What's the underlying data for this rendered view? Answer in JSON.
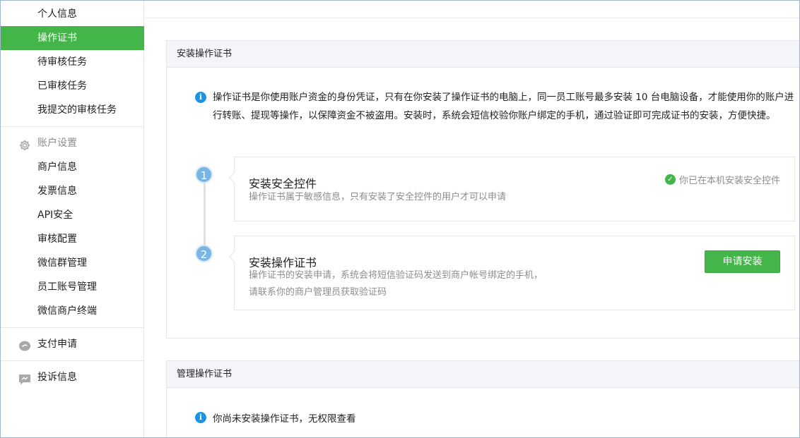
{
  "sidebar": {
    "top_items": [
      {
        "label": "个人信息"
      },
      {
        "label": "操作证书"
      },
      {
        "label": "待审核任务"
      },
      {
        "label": "已审核任务"
      },
      {
        "label": "我提交的审核任务"
      }
    ],
    "account_settings": {
      "title": "账户设置",
      "items": [
        {
          "label": "商户信息"
        },
        {
          "label": "发票信息"
        },
        {
          "label": "API安全"
        },
        {
          "label": "审核配置"
        },
        {
          "label": "微信群管理"
        },
        {
          "label": "员工账号管理"
        },
        {
          "label": "微信商户终端"
        }
      ]
    },
    "payment_apply": {
      "title": "支付申请"
    },
    "complaint_info": {
      "title": "投诉信息"
    }
  },
  "install_panel": {
    "title": "安装操作证书",
    "description": "操作证书是你使用账户资金的身份凭证，只有在你安装了操作证书的电脑上，同一员工账号最多安装 10 台电脑设备，才能使用你的账户进行转账、提现等操作，以保障资金不被盗用。安装时，系统会短信校验你账户绑定的手机，通过验证即可完成证书的安装，方便快捷。",
    "steps": [
      {
        "number": "1",
        "title": "安装安全控件",
        "subtitle": "操作证书属于敏感信息，只有安装了安全控件的用户才可以申请",
        "status": "你已在本机安装安全控件"
      },
      {
        "number": "2",
        "title": "安装操作证书",
        "subtitle_line1": "操作证书的安装申请，系统会将短信验证码发送到商户帐号绑定的手机，",
        "subtitle_line2": "请联系你的商户管理员获取验证码",
        "button": "申请安装"
      }
    ]
  },
  "manage_panel": {
    "title": "管理操作证书",
    "message": "你尚未安装操作证书，无权限查看"
  },
  "icons": {
    "info": "info-icon",
    "gear": "gear-icon",
    "chat": "chat-bubble-icon",
    "complaint": "message-icon",
    "check": "check-circle-icon"
  },
  "colors": {
    "accent": "#44b549",
    "info": "#1c93e6",
    "step": "#78b6e6"
  }
}
